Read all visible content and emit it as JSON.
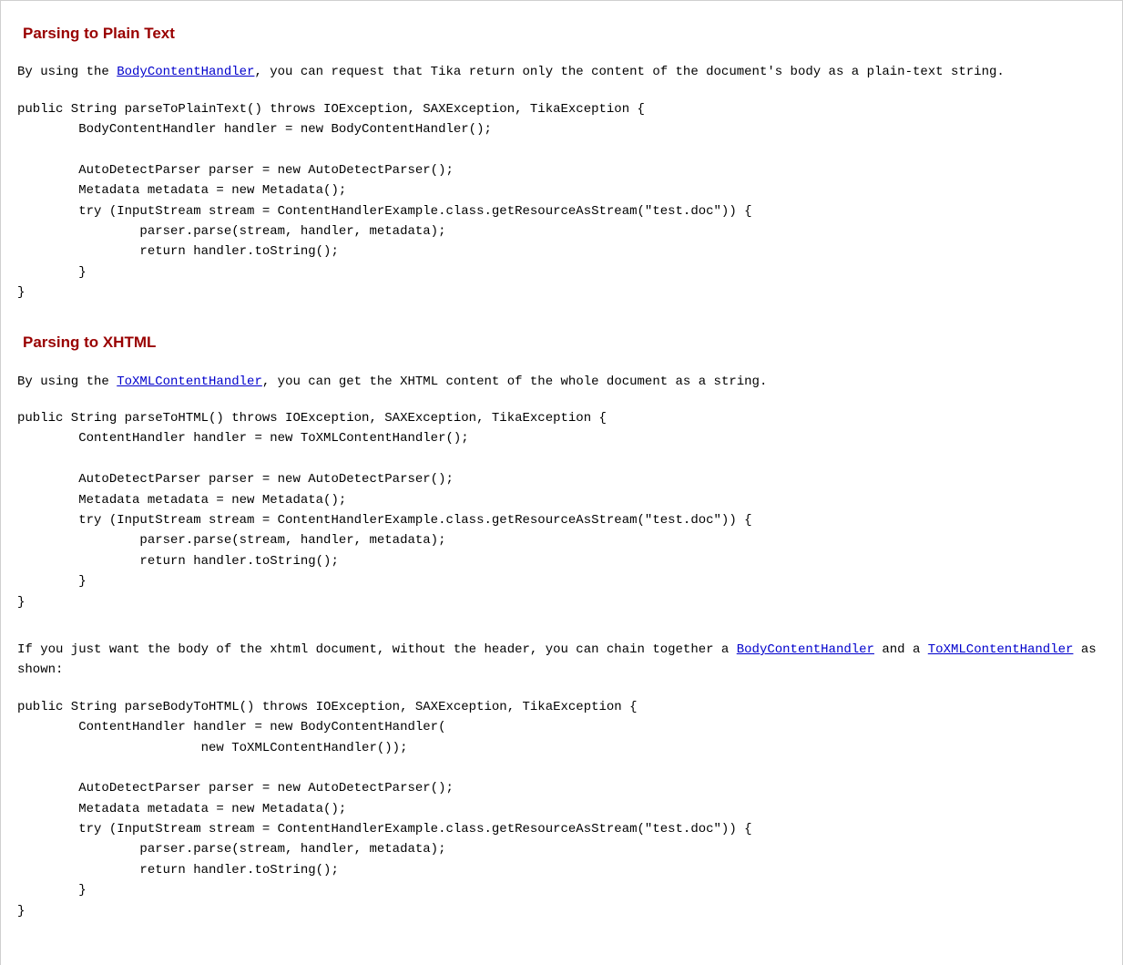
{
  "section1": {
    "heading": "Parsing to Plain Text",
    "para_prefix": "By using the ",
    "para_link": "BodyContentHandler",
    "para_suffix": ", you can request that Tika return only the content of the document's body as a plain-text string.",
    "code": "public String parseToPlainText() throws IOException, SAXException, TikaException {\n        BodyContentHandler handler = new BodyContentHandler();\n\n        AutoDetectParser parser = new AutoDetectParser();\n        Metadata metadata = new Metadata();\n        try (InputStream stream = ContentHandlerExample.class.getResourceAsStream(\"test.doc\")) {\n                parser.parse(stream, handler, metadata);\n                return handler.toString();\n        }\n}"
  },
  "section2": {
    "heading": "Parsing to XHTML",
    "para1_prefix": "By using the ",
    "para1_link": "ToXMLContentHandler",
    "para1_suffix": ", you can get the XHTML content of the whole document as a string.",
    "code1": "public String parseToHTML() throws IOException, SAXException, TikaException {\n        ContentHandler handler = new ToXMLContentHandler();\n\n        AutoDetectParser parser = new AutoDetectParser();\n        Metadata metadata = new Metadata();\n        try (InputStream stream = ContentHandlerExample.class.getResourceAsStream(\"test.doc\")) {\n                parser.parse(stream, handler, metadata);\n                return handler.toString();\n        }\n}",
    "para2_prefix": " If you just want the body of the xhtml document, without the header, you can chain together a ",
    "para2_link1": "BodyContentHandler",
    "para2_mid": " and a ",
    "para2_link2": "ToXMLContentHandler",
    "para2_suffix": " as shown:",
    "code2": "public String parseBodyToHTML() throws IOException, SAXException, TikaException {\n        ContentHandler handler = new BodyContentHandler(\n                        new ToXMLContentHandler());\n\n        AutoDetectParser parser = new AutoDetectParser();\n        Metadata metadata = new Metadata();\n        try (InputStream stream = ContentHandlerExample.class.getResourceAsStream(\"test.doc\")) {\n                parser.parse(stream, handler, metadata);\n                return handler.toString();\n        }\n}"
  }
}
